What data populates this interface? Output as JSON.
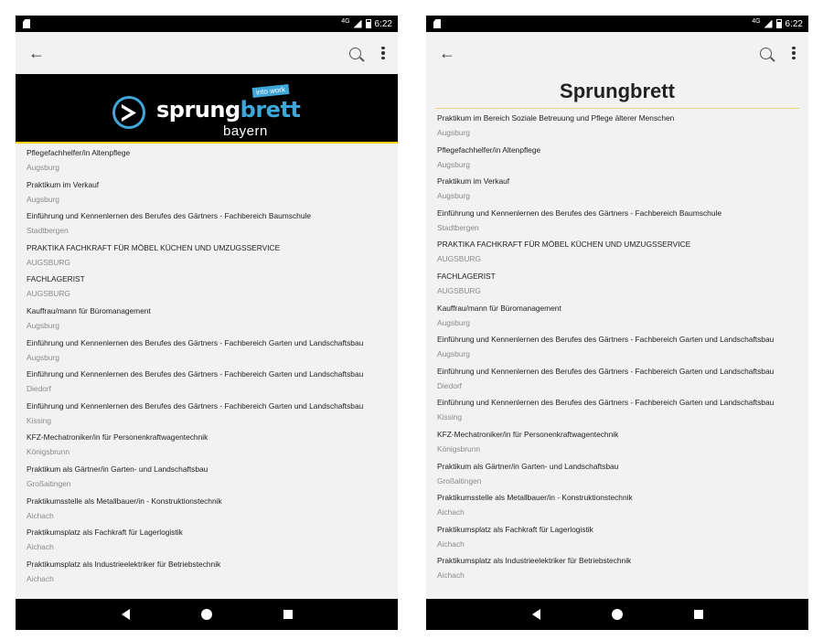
{
  "status": {
    "network": "4G",
    "time": "6:22"
  },
  "left": {
    "logo": {
      "main": "sprung",
      "accent": "brett",
      "region": "bayern",
      "tag": "into work"
    },
    "items": [
      {
        "title": "Pflegefachhelfer/in Altenpflege",
        "city": "Augsburg"
      },
      {
        "title": "Praktikum im Verkauf",
        "city": "Augsburg"
      },
      {
        "title": "Einführung und Kennenlernen des Berufes des Gärtners - Fachbereich Baumschule",
        "city": "Stadtbergen"
      },
      {
        "title": "PRAKTIKA FACHKRAFT FÜR MÖBEL KÜCHEN UND UMZUGSSERVICE",
        "city": "AUGSBURG"
      },
      {
        "title": "FACHLAGERIST",
        "city": "AUGSBURG"
      },
      {
        "title": "Kauffrau/mann für Büromanagement",
        "city": "Augsburg"
      },
      {
        "title": "Einführung und Kennenlernen des Berufes des Gärtners - Fachbereich Garten und Landschaftsbau",
        "city": "Augsburg"
      },
      {
        "title": "Einführung und Kennenlernen des Berufes des Gärtners - Fachbereich Garten und Landschaftsbau",
        "city": "Diedorf"
      },
      {
        "title": "Einführung und Kennenlernen des Berufes des Gärtners - Fachbereich Garten und Landschaftsbau",
        "city": "Kissing"
      },
      {
        "title": "KFZ-Mechatroniker/in für Personenkraftwagentechnik",
        "city": "Königsbrunn"
      },
      {
        "title": "Praktikum als Gärtner/in Garten- und Landschaftsbau",
        "city": "Großaitingen"
      },
      {
        "title": "Praktikumsstelle als Metallbauer/in - Konstruktionstechnik",
        "city": "Aichach"
      },
      {
        "title": "Praktikumsplatz als Fachkraft für Lagerlogistik",
        "city": "Aichach"
      },
      {
        "title": "Praktikumsplatz als Industrieelektriker für Betriebstechnik",
        "city": "Aichach"
      }
    ]
  },
  "right": {
    "title": "Sprungbrett",
    "items": [
      {
        "title": "Praktikum im Bereich Soziale Betreuung und Pflege älterer Menschen",
        "city": "Augsburg"
      },
      {
        "title": "Pflegefachhelfer/in Altenpflege",
        "city": "Augsburg"
      },
      {
        "title": "Praktikum im Verkauf",
        "city": "Augsburg"
      },
      {
        "title": "Einführung und Kennenlernen des Berufes des Gärtners - Fachbereich Baumschule",
        "city": "Stadtbergen"
      },
      {
        "title": "PRAKTIKA FACHKRAFT FÜR MÖBEL KÜCHEN UND UMZUGSSERVICE",
        "city": "AUGSBURG"
      },
      {
        "title": "FACHLAGERIST",
        "city": "AUGSBURG"
      },
      {
        "title": "Kauffrau/mann für Büromanagement",
        "city": "Augsburg"
      },
      {
        "title": "Einführung und Kennenlernen des Berufes des Gärtners - Fachbereich Garten und Landschaftsbau",
        "city": "Augsburg"
      },
      {
        "title": "Einführung und Kennenlernen des Berufes des Gärtners - Fachbereich Garten und Landschaftsbau",
        "city": "Diedorf"
      },
      {
        "title": "Einführung und Kennenlernen des Berufes des Gärtners - Fachbereich Garten und Landschaftsbau",
        "city": "Kissing"
      },
      {
        "title": "KFZ-Mechatroniker/in für Personenkraftwagentechnik",
        "city": "Königsbrunn"
      },
      {
        "title": "Praktikum als Gärtner/in Garten- und Landschaftsbau",
        "city": "Großaitingen"
      },
      {
        "title": "Praktikumsstelle als Metallbauer/in - Konstruktionstechnik",
        "city": "Aichach"
      },
      {
        "title": "Praktikumsplatz als Fachkraft für Lagerlogistik",
        "city": "Aichach"
      },
      {
        "title": "Praktikumsplatz als Industrieelektriker für Betriebstechnik",
        "city": "Aichach"
      }
    ]
  },
  "colors": {
    "accent_blue": "#3fa6d9",
    "banner_line": "#f3d300",
    "background": "#f2f2f2"
  },
  "icons": [
    "back-arrow-icon",
    "search-icon",
    "more-vert-icon",
    "nav-back-icon",
    "nav-home-icon",
    "nav-recents-icon"
  ]
}
